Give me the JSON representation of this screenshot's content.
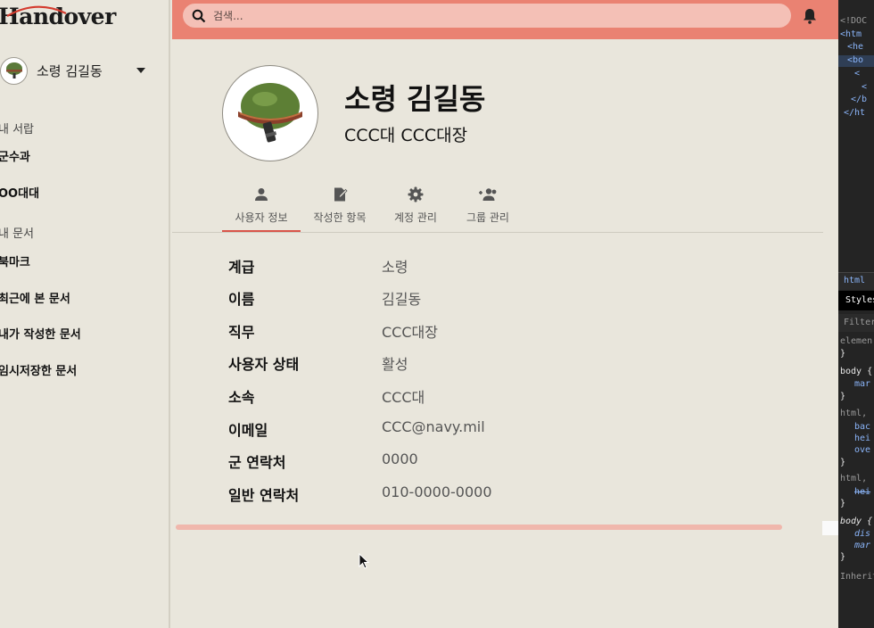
{
  "app": {
    "logo": "Handover"
  },
  "sidebar": {
    "user_name": "소령 김길동",
    "sections": [
      {
        "label": "내 서랍",
        "items": [
          "군수과",
          "OO대대"
        ]
      },
      {
        "label": "내 문서",
        "items": [
          "북마크",
          "최근에 본 문서",
          "내가 작성한 문서",
          "임시저장한 문서"
        ]
      }
    ]
  },
  "topbar": {
    "search_placeholder": "검색...",
    "icons": [
      "search-icon",
      "bell-icon"
    ]
  },
  "profile": {
    "name": "소령 김길동",
    "subtitle": "CCC대 CCC대장"
  },
  "tabs": [
    {
      "label": "사용자 정보",
      "icon": "person-icon",
      "active": true
    },
    {
      "label": "작성한 항목",
      "icon": "edit-note-icon",
      "active": false
    },
    {
      "label": "계정 관리",
      "icon": "gear-icon",
      "active": false
    },
    {
      "label": "그룹 관리",
      "icon": "group-add-icon",
      "active": false
    }
  ],
  "info": [
    {
      "key": "계급",
      "value": "소령"
    },
    {
      "key": "이름",
      "value": "김길동"
    },
    {
      "key": "직무",
      "value": "CCC대장"
    },
    {
      "key": "사용자 상태",
      "value": "활성"
    },
    {
      "key": "소속",
      "value": "CCC대"
    },
    {
      "key": "이메일",
      "value": "CCC@navy.mil"
    },
    {
      "key": "군 연락처",
      "value": "0000"
    },
    {
      "key": "일반 연락처",
      "value": "010-0000-0000"
    }
  ],
  "devtools": {
    "dom_lines": [
      "<!DOC",
      "<htm",
      "<he",
      "<bo",
      "<",
      "<",
      "</b",
      "</ht"
    ],
    "tab_label": "html",
    "styles_label": "Styles",
    "filter_label": "Filter",
    "rules": [
      "elemen",
      "}",
      "body {",
      "mar",
      "}",
      "html,",
      "bac",
      "hei",
      "ove",
      "}",
      "html,",
      "hei",
      "}",
      "body {",
      "dis",
      "mar",
      "}",
      "Inherite"
    ]
  },
  "colors": {
    "accent": "#ea8272",
    "search_bg": "#f4c0b6",
    "tab_underline": "#d9554a",
    "page_bg": "#e9e6dc"
  }
}
